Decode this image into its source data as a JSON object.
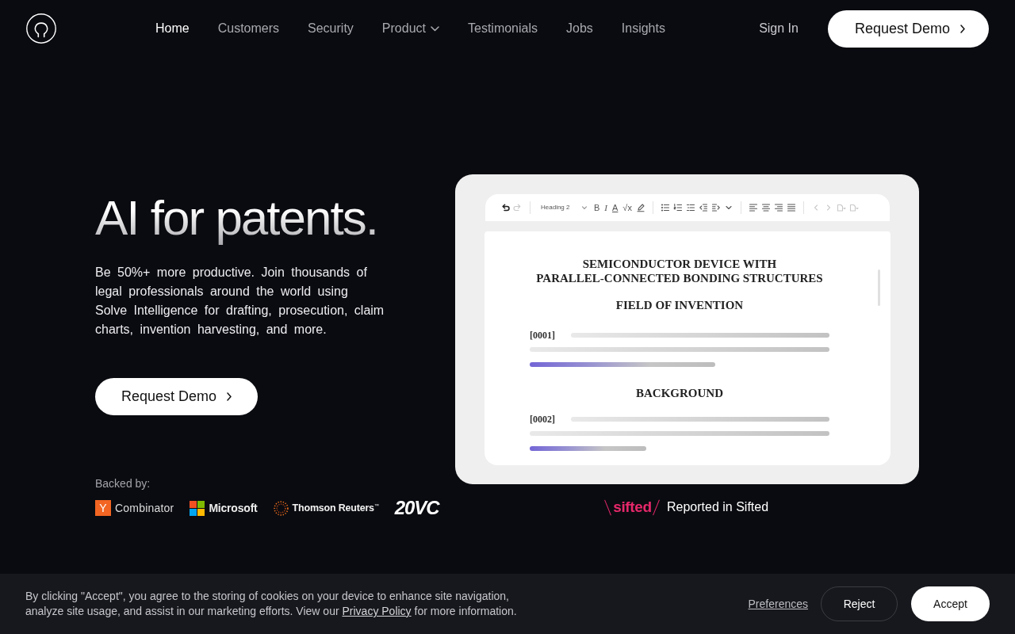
{
  "header": {
    "nav": [
      {
        "label": "Home",
        "kind": "link",
        "selected": true
      },
      {
        "label": "Customers",
        "kind": "link",
        "selected": false
      },
      {
        "label": "Security",
        "kind": "link",
        "selected": false
      },
      {
        "label": "Product",
        "kind": "menu",
        "selected": false
      },
      {
        "label": "Testimonials",
        "kind": "link",
        "selected": false
      },
      {
        "label": "Jobs",
        "kind": "link",
        "selected": false
      },
      {
        "label": "Insights",
        "kind": "link",
        "selected": false
      }
    ],
    "sign_in": "Sign In",
    "cta": "Request Demo"
  },
  "hero": {
    "title": "AI for patents.",
    "description": "Be 50%+ more productive. Join thousands of legal professionals around the world using Solve Intelligence for drafting, prosecution, claim charts, invention harvesting, and more.",
    "cta": "Request Demo",
    "backers_label": "Backed by:",
    "backers": [
      {
        "kind": "y-tile",
        "mark": "Y",
        "name": "Combinator"
      },
      {
        "kind": "four-squares",
        "name": "Microsoft"
      },
      {
        "kind": "dotted-ring",
        "name": "Thomson Reuters$^{™}$"
      },
      {
        "kind": "wordmark",
        "name": "20VC"
      }
    ]
  },
  "editor": {
    "toolbar": [
      {
        "items": [
          {
            "kind": "undo",
            "disabled": false
          },
          {
            "kind": "redo",
            "disabled": true
          }
        ]
      },
      {
        "items": [
          {
            "kind": "style-select",
            "label": "Heading 2",
            "disabled": false
          },
          {
            "kind": "bold",
            "label": "B",
            "disabled": false
          },
          {
            "kind": "italic",
            "label": "I",
            "disabled": false
          },
          {
            "kind": "font-color",
            "label": "A",
            "disabled": false
          },
          {
            "kind": "formula",
            "label": "√x",
            "disabled": false
          },
          {
            "kind": "highlight",
            "disabled": false
          }
        ]
      },
      {
        "items": [
          {
            "kind": "bullet-list",
            "disabled": false
          },
          {
            "kind": "numbered-list",
            "disabled": false
          },
          {
            "kind": "list",
            "disabled": false
          },
          {
            "kind": "outdent",
            "disabled": false
          },
          {
            "kind": "indent",
            "disabled": false
          },
          {
            "kind": "more",
            "disabled": false
          }
        ]
      },
      {
        "items": [
          {
            "kind": "align-left",
            "disabled": false
          },
          {
            "kind": "align-center",
            "disabled": false
          },
          {
            "kind": "align-right",
            "disabled": false
          },
          {
            "kind": "justify",
            "disabled": false
          }
        ]
      },
      {
        "items": [
          {
            "kind": "previous",
            "disabled": true
          },
          {
            "kind": "next",
            "disabled": true
          },
          {
            "kind": "page-menu",
            "disabled": true
          },
          {
            "kind": "page-menu",
            "disabled": true
          }
        ]
      }
    ],
    "document": {
      "title": [
        "SEMICONDUCTOR DEVICE WITH",
        "PARALLEL-CONNECTED BONDING STRUCTURES"
      ],
      "sections": [
        {
          "heading": "FIELD OF INVENTION",
          "paragraph": "[0001]"
        },
        {
          "heading": "BACKGROUND",
          "paragraph": "[0002]"
        }
      ]
    }
  },
  "press": {
    "outlet": "sifted",
    "note": "Reported in Sifted"
  },
  "cookie_banner": {
    "text": "By clicking \"Accept\", you agree to the storing of cookies on your device to enhance site navigation, analyze site usage, and assist in our marketing efforts. View our",
    "link": "Privacy Policy",
    "text_after": "for more information.",
    "preferences": "Preferences",
    "buttons": [
      {
        "label": "Reject",
        "kind": "reject"
      },
      {
        "label": "Accept",
        "kind": "accept"
      }
    ]
  }
}
